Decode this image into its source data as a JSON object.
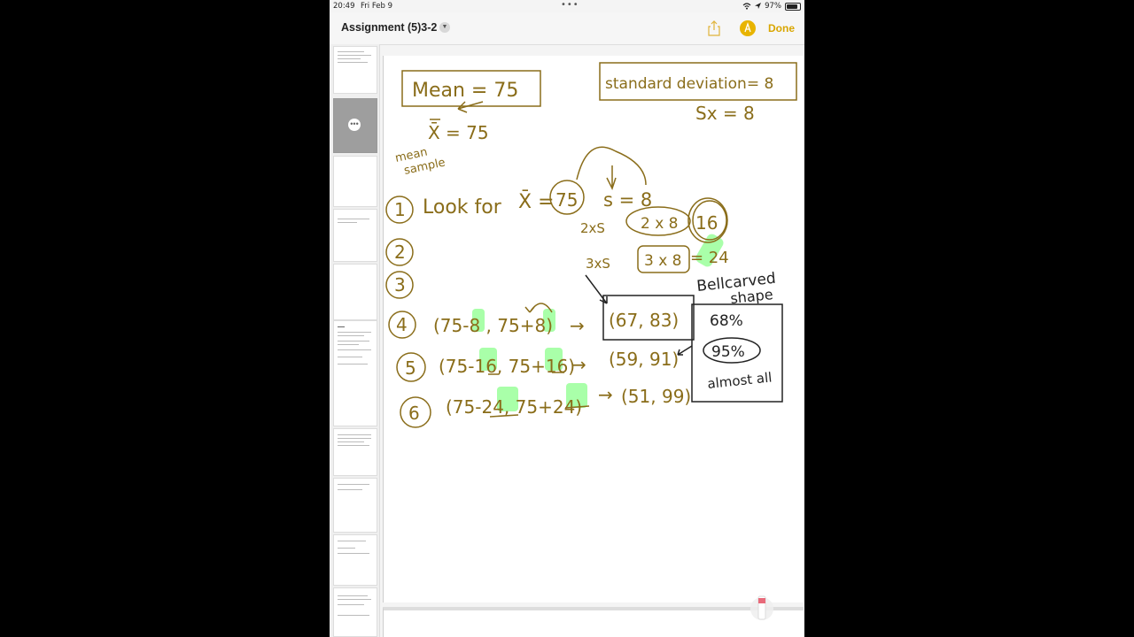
{
  "status_bar": {
    "time": "20:49",
    "date": "Fri Feb 9",
    "battery": "97%"
  },
  "toolbar": {
    "title": "Assignment (5)3-2",
    "done_label": "Done",
    "share_icon": "share-icon",
    "markup_icon": "markup-pen-icon"
  },
  "sidebar": {
    "more_icon": "ellipsis-icon"
  },
  "notes": {
    "mean_box": "Mean = 75",
    "sd_box": "standard deviation= 8",
    "sx": "Sx = 8",
    "xbar": "X̄ = 75",
    "mean_sample_1": "mean",
    "mean_sample_2": "sample",
    "step1": "1",
    "look_for": "Look for",
    "xbar_eq": "X̄ =",
    "xbar_val": "75",
    "s_eq": "s = 8",
    "two_s": "2xS",
    "two_x8": "2 x 8",
    "sixteen": "16",
    "step2": "2",
    "three_s": "3xS",
    "three_x8": "3 x 8",
    "eq_24": "= 24",
    "step3": "3",
    "bell_1": "Bellcarved",
    "bell_2": "shape",
    "step4": "4",
    "row4": "(75-8 , 75+8)",
    "ans4": "(67, 83)",
    "step5": "5",
    "row5": "(75-16, 75+16)",
    "ans5": "(59, 91)",
    "step6": "6",
    "row6": "(75-24, 75+24)",
    "ans6": "(51, 99)",
    "p68": "68%",
    "p95": "95%",
    "almost_all": "almost all",
    "arrow": "→"
  }
}
